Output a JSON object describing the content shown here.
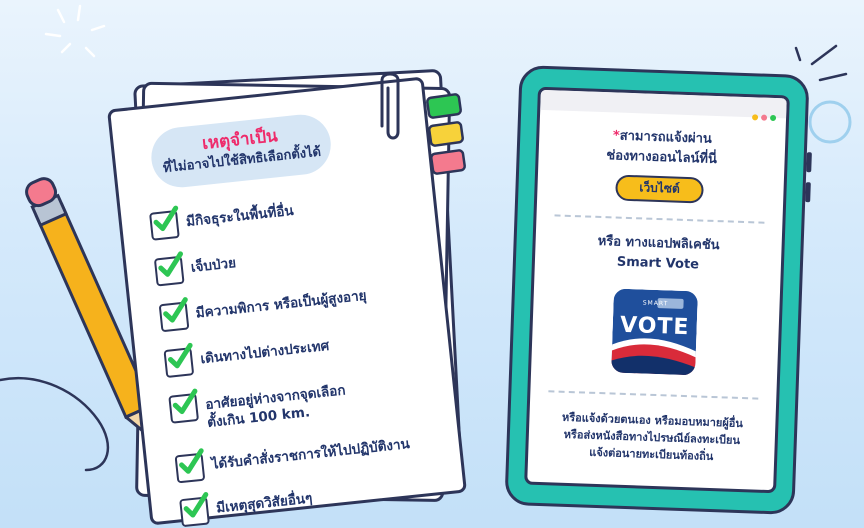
{
  "checklist": {
    "title": "เหตุจำเป็น",
    "subtitle": "ที่ไม่อาจไปใช้สิทธิเลือกตั้งได้",
    "items": [
      {
        "label": "มีกิจธุระในพื้นที่อื่น"
      },
      {
        "label": "เจ็บป่วย"
      },
      {
        "label": "มีความพิการ หรือเป็นผู้สูงอายุ"
      },
      {
        "label": "เดินทางไปต่างประเทศ"
      },
      {
        "label": "อาศัยอยู่ห่างจากจุดเลือก",
        "label_2": "ตั้งเกิน 100 km."
      },
      {
        "label": "ได้รับคำสั่งราชการให้ไปปฏิบัติงาน"
      },
      {
        "label": "มีเหตุสุดวิสัยอื่นๆ"
      }
    ]
  },
  "tablet": {
    "asterisk": "*",
    "online_line1": "สามารถแจ้งผ่าน",
    "online_line2": "ช่องทางออนไลน์ที่นี่",
    "website_button": "เว็บไซต์",
    "app_line1": "หรือ ทางแอปพลิเคชัน",
    "app_line2": "Smart Vote",
    "app_icon_small": "SMART",
    "app_icon_big": "VOTE",
    "footer_line1": "หรือแจ้งด้วยตนเอง หรือมอบหมายผู้อื่น",
    "footer_line2": "หรือส่งหนังสือทางไปรษณีย์ลงทะเบียน",
    "footer_line3": "แจ้งต่อนายทะเบียนท้องถิ่น"
  },
  "colors": {
    "title_pink": "#ee2b6b",
    "text_navy": "#22356b",
    "tablet_teal": "#26c1b1",
    "button_yellow": "#f7bd1b",
    "check_green": "#2dc653",
    "pencil_yellow": "#f6b21c",
    "pencil_eraser": "#f47a8e"
  },
  "icons": [
    "checkbox-check-icon",
    "paperclip-icon",
    "pencil-icon",
    "app-vote-icon"
  ]
}
